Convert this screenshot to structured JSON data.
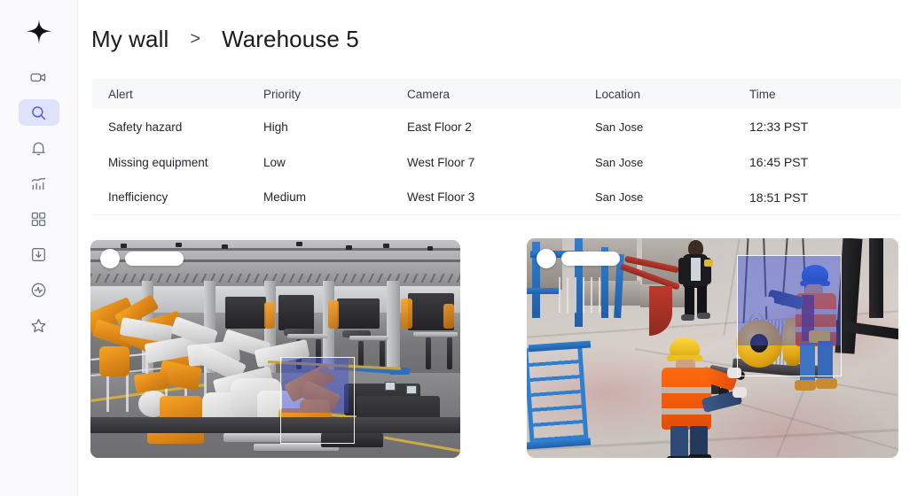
{
  "app": {
    "logo_icon": "sparkle-logo-icon",
    "accent_color": "#4d5ce8",
    "active_nav_bg": "#dfe2fb",
    "header_bg": "#f7f8fa"
  },
  "sidebar": {
    "items": [
      {
        "id": "cameras",
        "icon": "video-camera-icon",
        "active": false
      },
      {
        "id": "search",
        "icon": "search-icon",
        "active": true
      },
      {
        "id": "alerts",
        "icon": "bell-icon",
        "active": false
      },
      {
        "id": "analytics",
        "icon": "bar-chart-icon",
        "active": false
      },
      {
        "id": "apps",
        "icon": "grid-icon",
        "active": false
      },
      {
        "id": "downloads",
        "icon": "download-box-icon",
        "active": false
      },
      {
        "id": "activity",
        "icon": "activity-circle-icon",
        "active": false
      },
      {
        "id": "favorites",
        "icon": "star-icon",
        "active": false
      }
    ]
  },
  "header": {
    "breadcrumb": {
      "root": "My wall",
      "separator": ">",
      "current": "Warehouse 5"
    }
  },
  "table": {
    "columns": [
      "Alert",
      "Priority",
      "Camera",
      "Location",
      "Time"
    ],
    "rows": [
      {
        "alert": "Safety hazard",
        "priority": "High",
        "camera": "East Floor 2",
        "location": "San Jose",
        "time": "12:33 PST"
      },
      {
        "alert": "Missing equipment",
        "priority": "Low",
        "camera": "West Floor 7",
        "location": "San Jose",
        "time": "16:45 PST"
      },
      {
        "alert": "Inefficiency",
        "priority": "Medium",
        "camera": "West Floor 3",
        "location": "San Jose",
        "time": "18:51 PST"
      }
    ]
  },
  "cards": [
    {
      "id": "camera-feed-1",
      "scene": "factory-robot-assembly-line",
      "detection_overlay_color": "#3e50de",
      "bounding_box_color": "#ffffff",
      "control_knob": "playback-scrubber-knob",
      "control_track": "playback-scrubber-track"
    },
    {
      "id": "camera-feed-2",
      "scene": "warehouse-workers-cable-spool",
      "detection_overlay_color": "#3e50de",
      "bounding_box_color": "#ffffff",
      "control_knob": "playback-scrubber-knob",
      "control_track": "playback-scrubber-track"
    }
  ]
}
